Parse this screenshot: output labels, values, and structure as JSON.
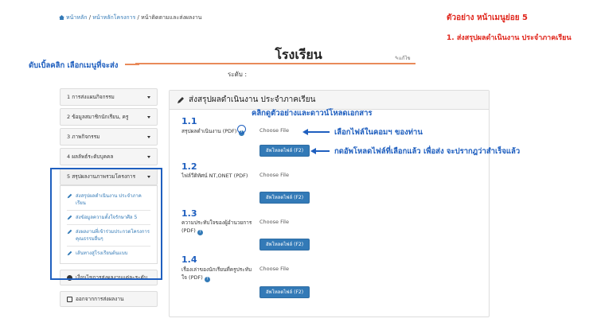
{
  "breadcrumb": {
    "home": "หน้าหลัก",
    "sep1": " / ",
    "parent": "หน้าหลักโครงการ",
    "sep2": " / ",
    "current": "หน้าติดตามและส่งผลงาน"
  },
  "annotations": {
    "example_title": "ตัวอย่าง หน้าเมนูย่อย 5",
    "example_sub": "1. ส่งสรุปผลดำเนินงาน ประจำภาคเรียน",
    "double_click": "ดับเบิ้ลคลิก เลือกเมนูที่จะส่ง",
    "click_example": "คลิกดูตัวอย่างและดาวน์โหลดเอกสาร",
    "choose_file_hint": "เลือกไฟล์ในคอมฯ ของท่าน",
    "upload_hint": "กดอัพโหลดไฟล์ที่เลือกแล้ว เพื่อส่ง จะปรากฎว่าสำเร็จแล้ว"
  },
  "page": {
    "title": "โรงเรียน",
    "edit_label": "แก้ไข",
    "level_label": "ระดับ :"
  },
  "menu": {
    "items": [
      {
        "label": "1 การส่งแผนกิจกรรม"
      },
      {
        "label": "2 ข้อมูลสมาชิกนักเรียน, ครู"
      },
      {
        "label": "3 ภาพกิจกรรม"
      },
      {
        "label": "4 ผลลัพธ์ระดับบุคคล"
      },
      {
        "label": "5 สรุปผลงานภาพรวมโครงการ"
      }
    ],
    "submenu": [
      {
        "label": "ส่งสรุปผลดำเนินงาน ประจำภาคเรียน"
      },
      {
        "label": "ส่งข้อมูลความตั้งใจรักษาศีล 5"
      },
      {
        "label": "ส่งผลงานที่เข้าร่วมประกวดโครงการคุณธรรมอื่นๆ"
      },
      {
        "label": "เส้นทางสู่โรงเรียนต้นแบบ"
      }
    ],
    "bottom": [
      {
        "label": "เงื่อนไขการส่งผลงานแต่ละระดับ"
      },
      {
        "label": "ออกจากการส่งผลงาน"
      }
    ]
  },
  "panel": {
    "heading": "ส่งสรุปผลดำเนินงาน ประจำภาคเรียน",
    "sections": [
      {
        "num": "1.1",
        "label": "สรุปผลดำเนินงาน (PDF)",
        "choose": "Choose File",
        "upload": "อัพโหลดไฟล์ (F2)"
      },
      {
        "num": "1.2",
        "label": "ไฟล์วีดิทัศน์ NT,ONET (PDF)",
        "choose": "Choose File",
        "upload": "อัพโหลดไฟล์ (F2)"
      },
      {
        "num": "1.3",
        "label": "ความประทับใจของผู้อำนวยการ (PDF)",
        "choose": "Choose File",
        "upload": "อัพโหลดไฟล์ (F2)"
      },
      {
        "num": "1.4",
        "label": "เรื่องเล่าของนักเรียนที่ครูประทับใจ (PDF)",
        "choose": "Choose File",
        "upload": "อัพโหลดไฟล์ (F2)"
      }
    ]
  },
  "colors": {
    "accent_blue": "#337ab7",
    "annotation_red": "#e0251b",
    "annotation_blue": "#1f5fbf",
    "divider_orange": "#e98a5a"
  }
}
